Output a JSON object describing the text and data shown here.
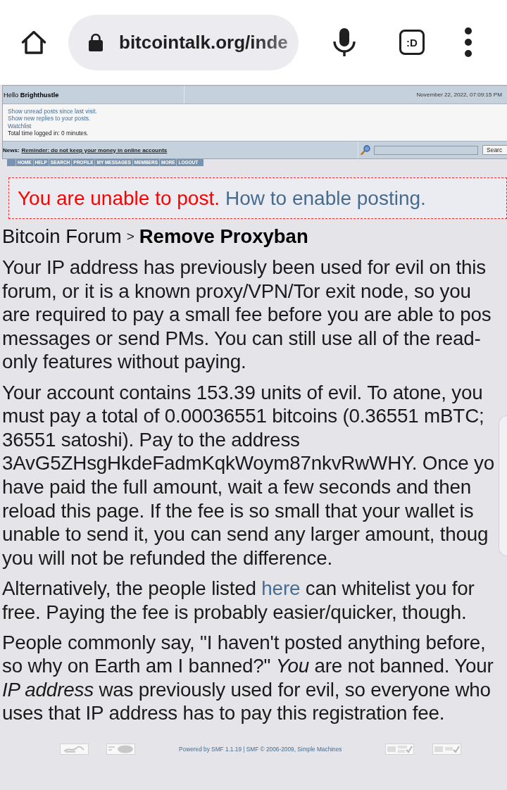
{
  "browser": {
    "url": "bitcointalk.org/inde",
    "tab_switcher": ":D"
  },
  "user_panel": {
    "greeting": "Hello **Brighthustle**",
    "date": "November 22, 2022, 07:09:15 PM",
    "links": [
      "Show unread posts since last visit.",
      "Show new replies to your posts.",
      "Watchlist"
    ],
    "time_logged_in": "Total time logged in: 0 minutes."
  },
  "news_bar": {
    "label": "News:",
    "reminder": "Reminder: do not keep your money in online accounts",
    "search_button": "Searc"
  },
  "menu": [
    "HOME",
    "HELP",
    "SEARCH",
    "PROFILE",
    "MY MESSAGES",
    "MEMBERS",
    "MORE",
    "LOGOUT"
  ],
  "notice": {
    "warning": "You are unable to post.",
    "link": "How to enable posting."
  },
  "breadcrumb": {
    "parent": "Bitcoin Forum",
    "separator": ">",
    "current": "Remove Proxyban"
  },
  "paragraphs": [
    {
      "kind": "plain",
      "lines": [
        "Your IP address has previously been used for evil on this",
        "forum, or it is a known proxy/VPN/Tor exit node, so you",
        "are required to pay a small fee before you are able to pos",
        "messages or send PMs. You can still use all of the read-",
        "only features without paying."
      ]
    },
    {
      "kind": "plain",
      "lines": [
        "Your account contains 153.39 units of evil. To atone, you",
        "must pay a total of 0.00036551 bitcoins (0.36551 mBTC;",
        "36551 satoshi). Pay to the address",
        "3AvG5ZHsgHkdeFadmKqkWoym87nkvRwWHY. Once yo",
        "have paid the full amount, wait a few seconds and then",
        "reload this page. If the fee is so small that your wallet is",
        "unable to send it, you can send any larger amount, thoug",
        "you will not be refunded the difference."
      ]
    },
    {
      "kind": "linked",
      "before": "Alternatively, the people listed ",
      "link": "here",
      "after": " can whitelist you for",
      "lines": [
        "free. Paying the fee is probably easier/quicker, though."
      ]
    },
    {
      "kind": "plain",
      "lines": [
        "People commonly say, \"I haven't posted anything before,",
        "so why on Earth am I banned?\" *You* are not banned. Your",
        "*IP address* was previously used for evil, so everyone who",
        "uses that IP address has to pay this registration fee."
      ]
    }
  ],
  "footer": {
    "credits": "Powered by SMF 1.1.19 | SMF © 2006-2009, Simple Machines"
  }
}
